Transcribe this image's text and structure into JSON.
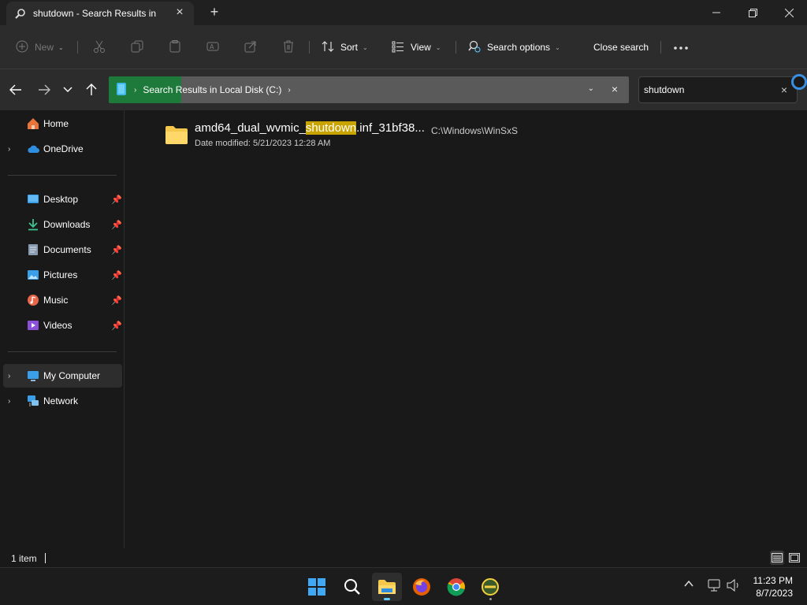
{
  "tab": {
    "title": "shutdown - Search Results in",
    "icon": "search-icon"
  },
  "toolbar": {
    "new_label": "New",
    "sort_label": "Sort",
    "view_label": "View",
    "search_options_label": "Search options",
    "close_search_label": "Close search"
  },
  "address": {
    "location": "Search Results in Local Disk (C:)",
    "progress_fraction": 0.14
  },
  "search": {
    "value": "shutdown"
  },
  "sidebar": {
    "home": "Home",
    "onedrive": "OneDrive",
    "quick_access": [
      {
        "label": "Desktop",
        "icon": "desktop-icon"
      },
      {
        "label": "Downloads",
        "icon": "download-icon"
      },
      {
        "label": "Documents",
        "icon": "documents-icon"
      },
      {
        "label": "Pictures",
        "icon": "pictures-icon"
      },
      {
        "label": "Music",
        "icon": "music-icon"
      },
      {
        "label": "Videos",
        "icon": "videos-icon"
      }
    ],
    "my_computer": "My Computer",
    "network": "Network"
  },
  "results": [
    {
      "name_prefix": "amd64_dual_wvmic_",
      "name_highlight": "shutdown",
      "name_suffix": ".inf_31bf38...",
      "date_modified_label": "Date modified:",
      "date_modified": "5/21/2023 12:28 AM",
      "path": "C:\\Windows\\WinSxS"
    }
  ],
  "status": {
    "item_count": "1 item"
  },
  "clock": {
    "time": "11:23 PM",
    "date": "8/7/2023"
  },
  "colors": {
    "accent": "#60cdff",
    "highlight": "#c9a400",
    "progress": "#1e7a3a",
    "folder": "#f5c84c"
  }
}
